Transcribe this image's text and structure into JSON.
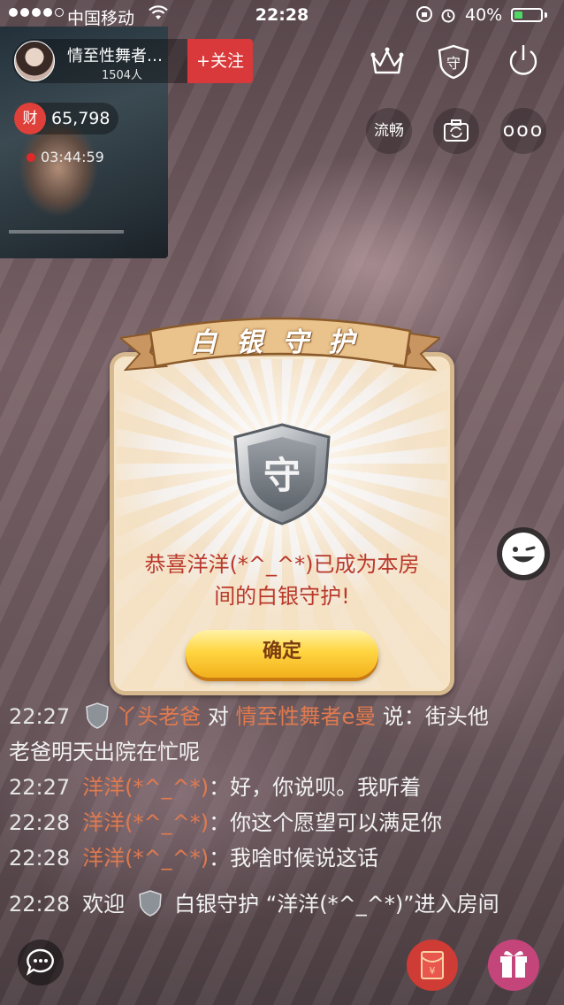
{
  "status_bar": {
    "carrier": "中国移动",
    "time": "22:28",
    "battery": "40%",
    "battery_level": 0.4
  },
  "host": {
    "name": "情至性舞者…",
    "viewers": "1504人",
    "follow_label": "+关注"
  },
  "stats": {
    "wealth_badge": "财",
    "wealth_value": "65,798",
    "live_duration": "03:44:59"
  },
  "controls": {
    "smooth_label": "流畅",
    "more_label": "ooo"
  },
  "dialog": {
    "title": "白银守护",
    "badge_char": "守",
    "message_line1": "恭喜洋洋(*^_^*)已成为本房",
    "message_line2": "间的白银守护!",
    "ok_label": "确定"
  },
  "chat": [
    {
      "time": "22:27",
      "user": "丫头老爸",
      "mid": "对",
      "target": "情至性舞者e曼",
      "text": "说：街头他",
      "cont": "老爸明天出院在忙呢"
    },
    {
      "time": "22:27",
      "user": "洋洋(*^_^*)",
      "text": "：好，你说呗。我听着"
    },
    {
      "time": "22:28",
      "user": "洋洋(*^_^*)",
      "text": "：你这个愿望可以满足你"
    },
    {
      "time": "22:28",
      "user": "洋洋(*^_^*)",
      "text": "：我啥时候说这话"
    },
    {
      "time": "22:28",
      "pre": "欢迎",
      "text": "白银守护 “洋洋(*^_^*)”进入房间"
    }
  ],
  "colors": {
    "accent_red": "#d9393a",
    "chat_username": "#e07a4f",
    "dialog_text": "#b9392b",
    "button_yellow": "#ffd642"
  },
  "icons": [
    "wifi-icon",
    "crown-icon",
    "guard-shield-icon",
    "power-icon",
    "camera-switch-icon",
    "more-icon",
    "emoji-icon",
    "chat-bubble-icon",
    "red-envelope-icon",
    "gift-icon"
  ]
}
